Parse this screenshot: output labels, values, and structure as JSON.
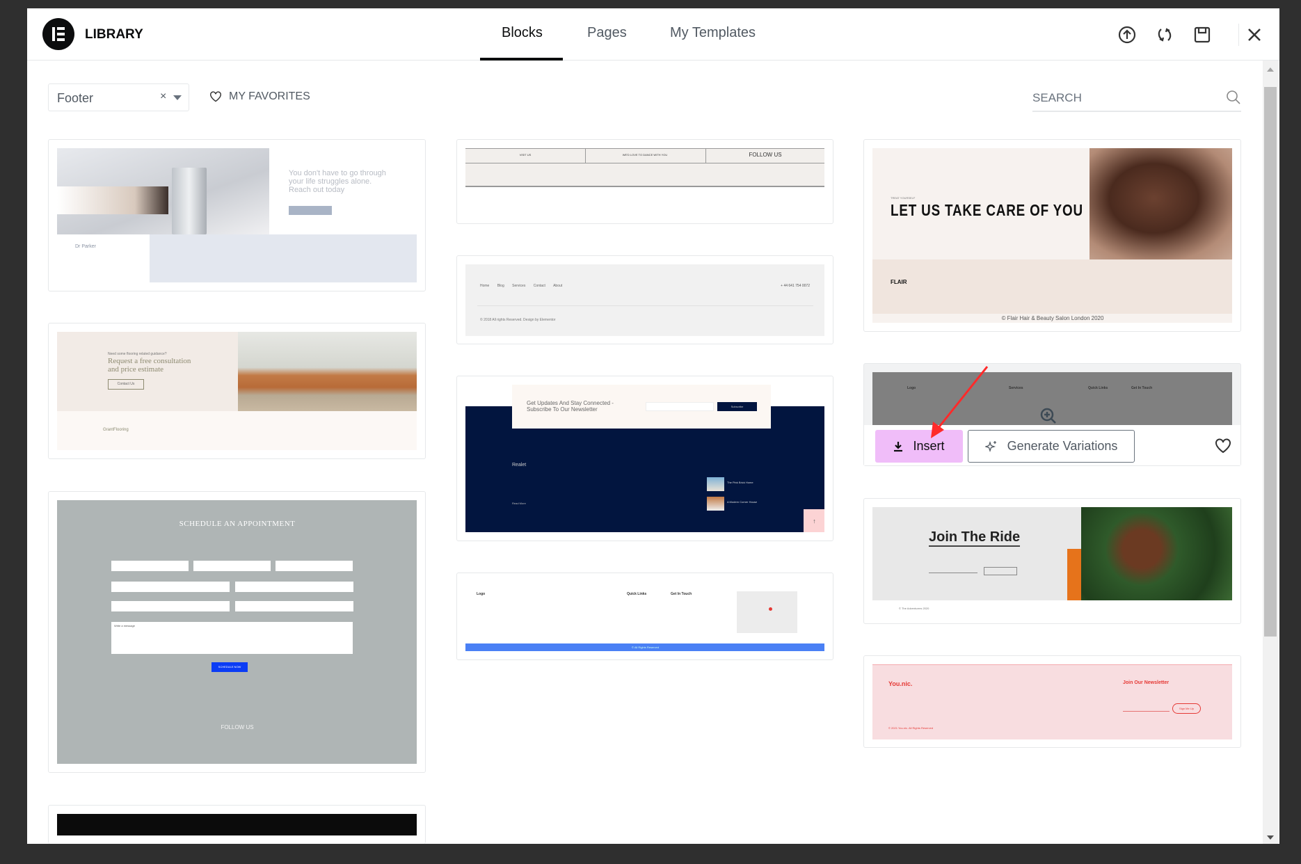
{
  "header": {
    "title": "LIBRARY",
    "tabs": [
      {
        "label": "Blocks",
        "active": true
      },
      {
        "label": "Pages"
      },
      {
        "label": "My Templates"
      }
    ],
    "icons": [
      "upload-icon",
      "sync-icon",
      "save-icon",
      "close-icon"
    ]
  },
  "toolbar": {
    "filter_value": "Footer",
    "clear": "×",
    "favorites": "MY FAVORITES",
    "search_placeholder": "SEARCH"
  },
  "hover_actions": {
    "insert": "Insert",
    "generate": "Generate Variations"
  },
  "colors": {
    "insert_bg": "#f0bdf9",
    "arrow": "#ff2a2a"
  },
  "blocks": {
    "psych": {
      "headline": "You don't have to go through your life struggles alone. Reach out today",
      "name": "Dr Parker"
    },
    "flooring": {
      "kicker": "Need some flooring related guidance?",
      "headline": "Request a free consultation and price estimate",
      "button": "Contact Us",
      "brand": "GrantFlooring"
    },
    "appointment": {
      "title": "SCHEDULE AN APPOINTMENT",
      "button": "SCHEDULE NOW",
      "message": "Write a message",
      "follow": "FOLLOW US"
    },
    "dance": {
      "col1": "VISIT US",
      "col2": "WE'D LOVE TO DANCE WITH YOU",
      "col3": "FOLLOW US"
    },
    "simple": {
      "links": [
        "Home",
        "Blog",
        "Services",
        "Contact",
        "About"
      ],
      "phone": "+ 44 641 754 0072",
      "copyright": "© 2018 All rights Reserved. Design by Elementor"
    },
    "realet": {
      "headline": "Get Updates And Stay Connected - Subscribe To Our Newsletter",
      "button": "Subscribe",
      "brand": "Realet",
      "p1": "The Pink Brick Home",
      "p2": "A Modern Corner House",
      "read": "Read More"
    },
    "logo_footer": {
      "logo": "Logo",
      "links": "Quick Links",
      "touch": "Get In Touch",
      "bar": "© All Rights Reserved"
    },
    "flair": {
      "kicker": "TREAT YOURSELF",
      "headline": "LET US TAKE CARE OF YOU",
      "logo": "FLAIR",
      "copyright": "© Flair Hair & Beauty Salon London 2020"
    },
    "gray": {
      "c1": "Logo",
      "c2": "Services",
      "c3": "Quick Links",
      "c4": "Get In Touch"
    },
    "ride": {
      "headline": "Join The Ride",
      "copyright": "© The Adventurers 2020"
    },
    "younic": {
      "brand": "You.nic.",
      "newsletter": "Join Our Newsletter",
      "button": "Sign Me Up",
      "copyright": "© 2021 You.nic. All Rights Reserved"
    }
  }
}
